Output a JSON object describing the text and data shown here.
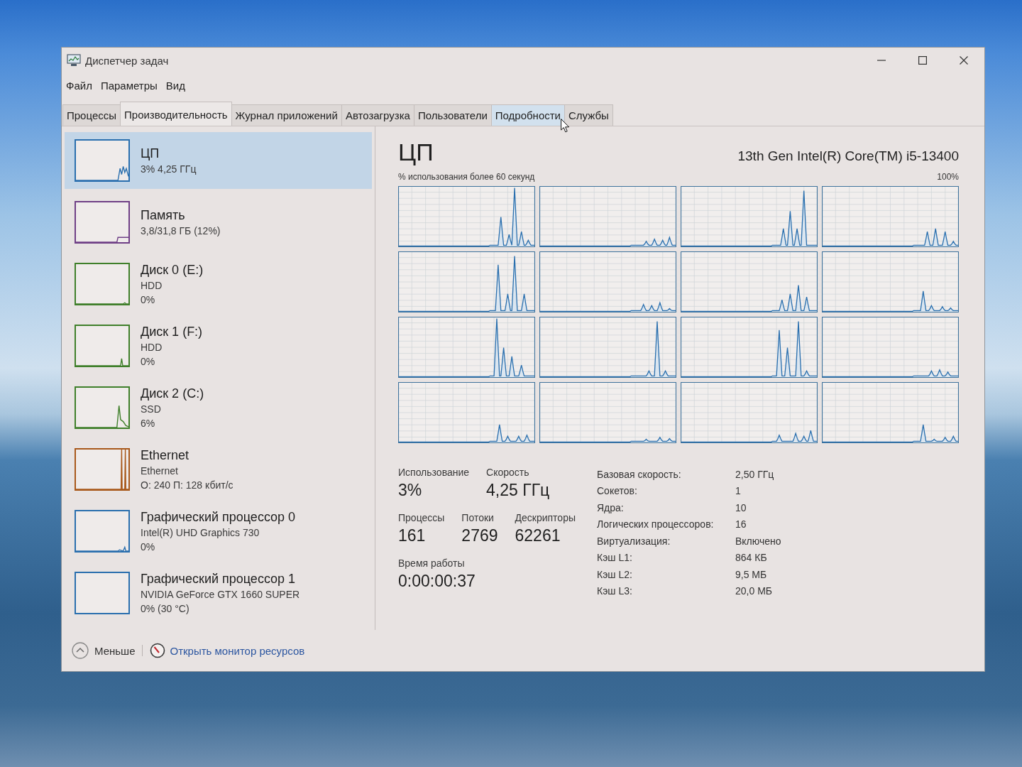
{
  "window": {
    "title": "Диспетчер задач"
  },
  "menu": [
    "Файл",
    "Параметры",
    "Вид"
  ],
  "tabs": [
    {
      "label": "Процессы",
      "selected": false,
      "hovered": false
    },
    {
      "label": "Производительность",
      "selected": true,
      "hovered": false
    },
    {
      "label": "Журнал приложений",
      "selected": false,
      "hovered": false
    },
    {
      "label": "Автозагрузка",
      "selected": false,
      "hovered": false
    },
    {
      "label": "Пользователи",
      "selected": false,
      "hovered": false
    },
    {
      "label": "Подробности",
      "selected": false,
      "hovered": true
    },
    {
      "label": "Службы",
      "selected": false,
      "hovered": false
    }
  ],
  "sidebar": {
    "items": [
      {
        "title": "ЦП",
        "details": [
          "3% 4,25 ГГц"
        ],
        "color": "#2a6fae",
        "selected": true
      },
      {
        "title": "Память",
        "details": [
          "3,8/31,8 ГБ (12%)"
        ],
        "color": "#6f3f86",
        "selected": false
      },
      {
        "title": "Диск 0 (E:)",
        "details": [
          "HDD",
          "0%"
        ],
        "color": "#3f7f2a",
        "selected": false
      },
      {
        "title": "Диск 1 (F:)",
        "details": [
          "HDD",
          "0%"
        ],
        "color": "#3f7f2a",
        "selected": false
      },
      {
        "title": "Диск 2 (C:)",
        "details": [
          "SSD",
          "6%"
        ],
        "color": "#3f7f2a",
        "selected": false
      },
      {
        "title": "Ethernet",
        "details": [
          "Ethernet",
          "О: 240 П: 128 кбит/с"
        ],
        "color": "#a8581a",
        "selected": false
      },
      {
        "title": "Графический процессор 0",
        "details": [
          "Intel(R) UHD Graphics 730",
          "0%"
        ],
        "color": "#2a6fae",
        "selected": false
      },
      {
        "title": "Графический процессор 1",
        "details": [
          "NVIDIA GeForce GTX 1660 SUPER",
          "0% (30 °C)"
        ],
        "color": "#2a6fae",
        "selected": false
      }
    ]
  },
  "panel": {
    "title": "ЦП",
    "subtitle": "13th Gen Intel(R) Core(TM) i5-13400",
    "graph_caption": "% использования более 60 секунд",
    "graph_max": "100%",
    "stat_rows": [
      {
        "items": [
          {
            "label": "Использование",
            "value": "3%"
          },
          {
            "label": "Скорость",
            "value": "4,25 ГГц"
          }
        ]
      },
      {
        "items": [
          {
            "label": "Процессы",
            "value": "161"
          },
          {
            "label": "Потоки",
            "value": "2769"
          },
          {
            "label": "Дескрипторы",
            "value": "62261"
          }
        ]
      },
      {
        "items": [
          {
            "label": "Время работы",
            "value": "0:00:00:37"
          }
        ]
      }
    ],
    "specs": [
      {
        "label": "Базовая скорость:",
        "value": "2,50 ГГц"
      },
      {
        "label": "Сокетов:",
        "value": "1"
      },
      {
        "label": "Ядра:",
        "value": "10"
      },
      {
        "label": "Логических процессоров:",
        "value": "16"
      },
      {
        "label": "Виртуализация:",
        "value": "Включено"
      },
      {
        "label": "Кэш L1:",
        "value": "864 КБ"
      },
      {
        "label": "Кэш L2:",
        "value": "9,5 МБ"
      },
      {
        "label": "Кэш L3:",
        "value": "20,0 МБ"
      }
    ]
  },
  "footer": {
    "collapse": "Меньше",
    "link": "Открыть монитор ресурсов"
  }
}
